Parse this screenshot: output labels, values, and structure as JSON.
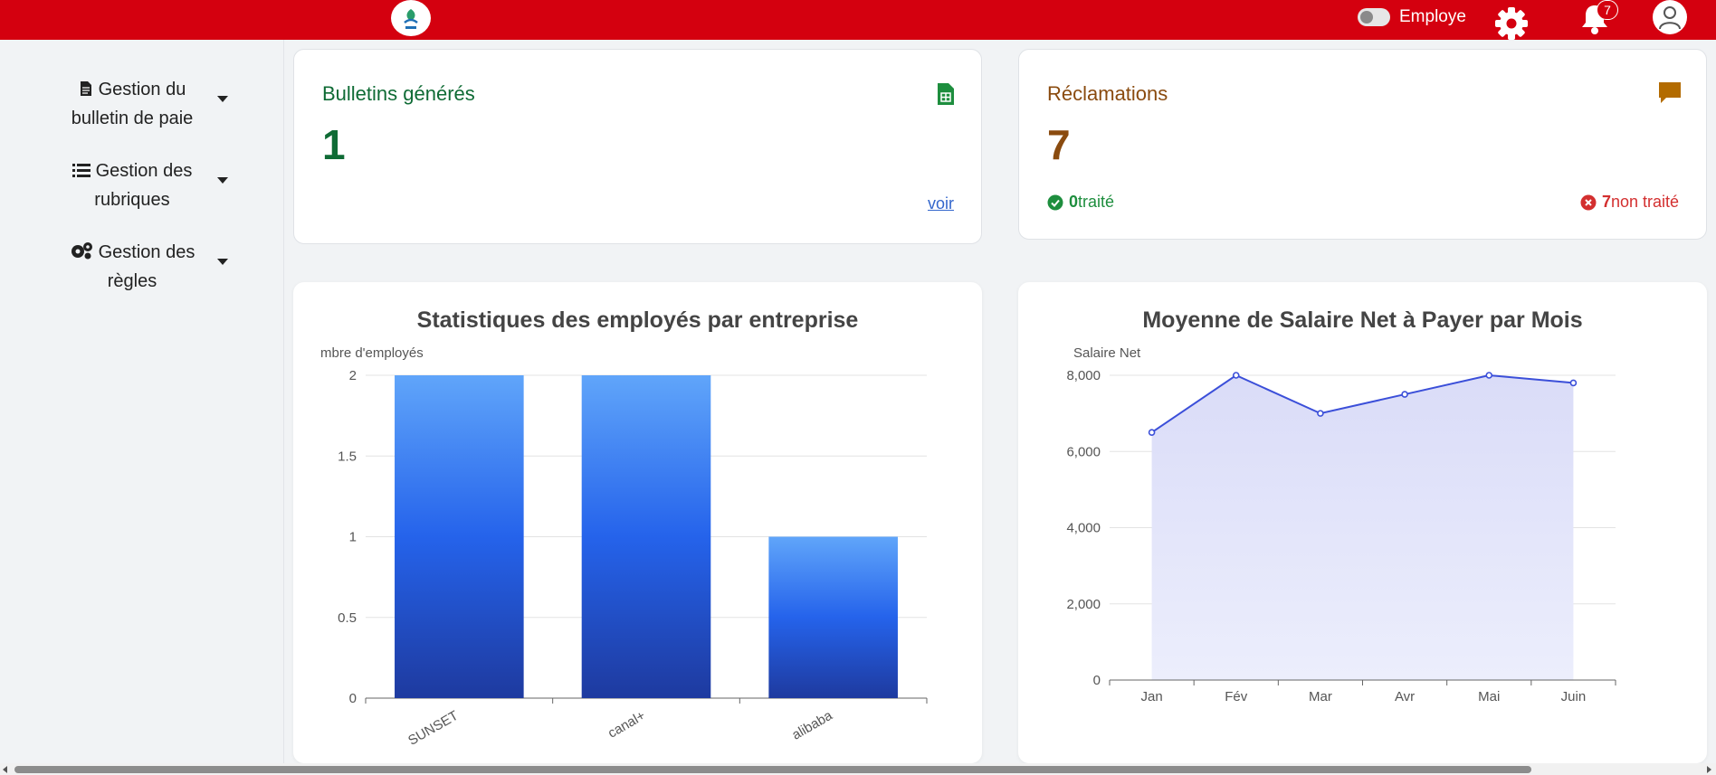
{
  "header": {
    "toggle_label": "Employe",
    "notification_count": "7",
    "brand_color": "#d4000f"
  },
  "sidebar": {
    "items": [
      {
        "label": "Gestion du bulletin de paie",
        "icon": "file-icon"
      },
      {
        "label": "Gestion des rubriques",
        "icon": "list-icon"
      },
      {
        "label": "Gestion des règles",
        "icon": "gears-icon"
      }
    ]
  },
  "cards": {
    "bulletins": {
      "title": "Bulletins générés",
      "value": "1",
      "link": "voir",
      "color": "#0f6b35"
    },
    "reclamations": {
      "title": "Réclamations",
      "value": "7",
      "color": "#8a4b0f",
      "traite_count": "0",
      "traite_label": "traité",
      "non_traite_count": "7",
      "non_traite_label": "non traité"
    }
  },
  "chart_data": [
    {
      "type": "bar",
      "title": "Statistiques des employés par entreprise",
      "ylabel": "mbre d'employés",
      "categories": [
        "SUNSET",
        "canal+",
        "alibaba"
      ],
      "values": [
        2,
        2,
        1
      ],
      "ylim": [
        0,
        2
      ],
      "yticks": [
        "0",
        "0.5",
        "1",
        "1.5",
        "2"
      ],
      "grid": true,
      "colors": [
        "#60a5fa",
        "#2563eb",
        "#1e3a9f"
      ]
    },
    {
      "type": "area",
      "title": "Moyenne de Salaire Net à Payer par Mois",
      "ylabel": "Salaire Net",
      "categories": [
        "Jan",
        "Fév",
        "Mar",
        "Avr",
        "Mai",
        "Juin"
      ],
      "values": [
        6500,
        8000,
        7000,
        7500,
        8000,
        7800
      ],
      "ylim": [
        0,
        8000
      ],
      "yticks": [
        "0",
        "2,000",
        "4,000",
        "6,000",
        "8,000"
      ],
      "grid": true,
      "colors": [
        "#3b4fd9",
        "#dadcf8"
      ]
    }
  ]
}
